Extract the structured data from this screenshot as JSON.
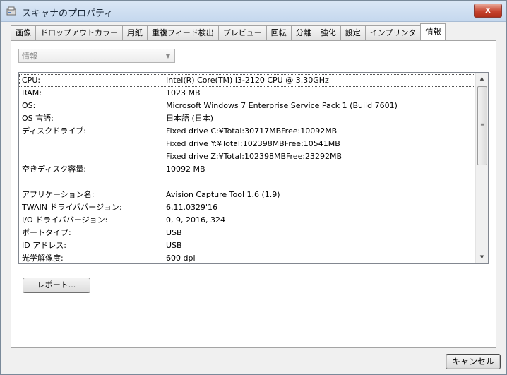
{
  "window": {
    "title": "スキャナのプロパティ",
    "close_label": "x"
  },
  "tabs": [
    {
      "label": "画像"
    },
    {
      "label": "ドロップアウトカラー"
    },
    {
      "label": "用紙"
    },
    {
      "label": "重複フィード検出"
    },
    {
      "label": "プレビュー"
    },
    {
      "label": "回転"
    },
    {
      "label": "分離"
    },
    {
      "label": "強化"
    },
    {
      "label": "設定"
    },
    {
      "label": "インプリンタ"
    },
    {
      "label": "情報",
      "active": true
    }
  ],
  "info_selector": {
    "value": "情報"
  },
  "info_rows": [
    {
      "key": "CPU:",
      "value": "Intel(R) Core(TM) i3-2120 CPU @ 3.30GHz"
    },
    {
      "key": "RAM:",
      "value": "1023 MB"
    },
    {
      "key": "OS:",
      "value": "Microsoft Windows 7 Enterprise Service Pack 1 (Build 7601)"
    },
    {
      "key": "OS 言語:",
      "value": "日本語 (日本)"
    },
    {
      "key": "ディスクドライブ:",
      "value": "Fixed drive C:¥Total:30717MBFree:10092MB"
    },
    {
      "key": "",
      "value": "Fixed drive Y:¥Total:102398MBFree:10541MB"
    },
    {
      "key": "",
      "value": "Fixed drive Z:¥Total:102398MBFree:23292MB"
    },
    {
      "key": "空きディスク容量:",
      "value": "10092 MB"
    },
    {
      "key": "",
      "value": ""
    },
    {
      "key": "アプリケーション名:",
      "value": "Avision Capture Tool 1.6 (1.9)"
    },
    {
      "key": "TWAIN ドライババージョン:",
      "value": "6.11.0329'16"
    },
    {
      "key": "I/O ドライババージョン:",
      "value": "0, 9, 2016, 324"
    },
    {
      "key": "ポートタイプ:",
      "value": "USB"
    },
    {
      "key": "ID アドレス:",
      "value": "USB"
    },
    {
      "key": "光学解像度:",
      "value": "600 dpi"
    }
  ],
  "buttons": {
    "report": "レポート...",
    "cancel": "キャンセル"
  },
  "icons": {
    "app": "scanner-icon",
    "dropdown": "chevron-down-icon",
    "scroll_up": "arrow-up-icon",
    "scroll_down": "arrow-down-icon"
  }
}
